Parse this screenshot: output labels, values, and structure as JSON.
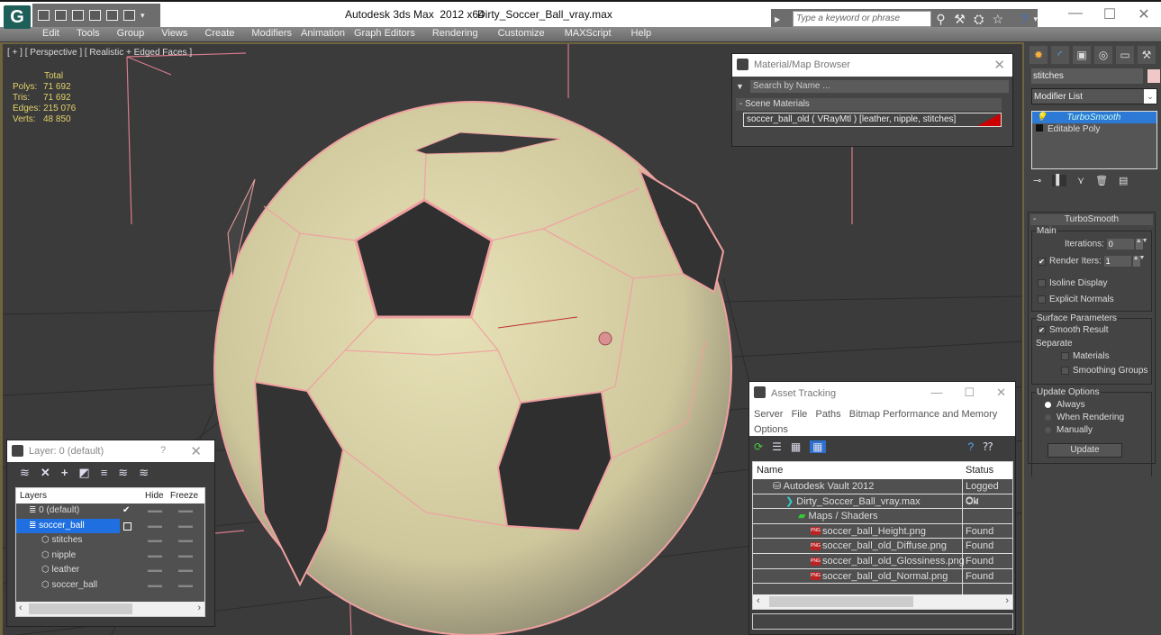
{
  "titlebar": {
    "app_title": "Autodesk 3ds Max  2012 x64",
    "document": "Dirty_Soccer_Ball_vray.max",
    "search_placeholder": "Type a keyword or phrase",
    "help_icon": "?"
  },
  "menu": [
    "Edit",
    "Tools",
    "Group",
    "Views",
    "Create",
    "Modifiers",
    "Animation",
    "Graph Editors",
    "Rendering",
    "Customize",
    "MAXScript",
    "Help"
  ],
  "viewport": {
    "label": "[ + ] [ Perspective ] [ Realistic + Edged Faces ]",
    "stats": {
      "header": "Total",
      "rows": [
        {
          "label": "Polys:",
          "value": "71 692"
        },
        {
          "label": "Tris:",
          "value": "71 692"
        },
        {
          "label": "Edges:",
          "value": "215 076"
        },
        {
          "label": "Verts:",
          "value": "48 850"
        }
      ]
    },
    "wire_color": "#f0a0a0"
  },
  "material_browser": {
    "title": "Material/Map Browser",
    "search_placeholder": "Search by Name ...",
    "group": "- Scene Materials",
    "item": "soccer_ball_old  ( VRayMtl ) [leather, nipple, stitches]"
  },
  "command_panel": {
    "object_name": "stitches",
    "object_color": "#f0c8c8",
    "modifier_list": "Modifier List",
    "stack": [
      {
        "label": "TurboSmooth",
        "selected": true
      },
      {
        "label": "Editable Poly",
        "selected": false
      }
    ],
    "turbosmooth": {
      "title": "TurboSmooth",
      "main_group": "Main",
      "iterations_label": "Iterations:",
      "iterations": "0",
      "render_iters_label": "Render Iters:",
      "render_iters": "1",
      "render_iters_checked": true,
      "isoline_label": "Isoline Display",
      "explicit_normals_label": "Explicit Normals",
      "surface_group": "Surface Parameters",
      "smooth_result_label": "Smooth Result",
      "separate_label": "Separate",
      "materials_label": "Materials",
      "smoothing_groups_label": "Smoothing Groups",
      "update_group": "Update Options",
      "update_options": [
        "Always",
        "When Rendering",
        "Manually"
      ],
      "update_selected": "Always",
      "update_button": "Update"
    }
  },
  "layer_dialog": {
    "title": "Layer: 0 (default)",
    "help": "?",
    "columns": {
      "layers": "Layers",
      "hide": "Hide",
      "freeze": "Freeze"
    },
    "rows": [
      {
        "name": "0 (default)",
        "level": 0,
        "current": true,
        "selected": false
      },
      {
        "name": "soccer_ball",
        "level": 0,
        "current": false,
        "selected": true
      },
      {
        "name": "stitches",
        "level": 1
      },
      {
        "name": "nipple",
        "level": 1
      },
      {
        "name": "leather",
        "level": 1
      },
      {
        "name": "soccer_ball",
        "level": 1
      }
    ]
  },
  "asset_tracking": {
    "title": "Asset Tracking",
    "menu": [
      "Server",
      "File",
      "Paths",
      "Bitmap Performance and Memory",
      "Options"
    ],
    "columns": {
      "name": "Name",
      "status": "Status"
    },
    "rows": [
      {
        "name": "Autodesk Vault 2012",
        "status": "Logged Ou",
        "level": 1
      },
      {
        "name": "Dirty_Soccer_Ball_vray.max",
        "status": "Ok",
        "level": 2
      },
      {
        "name": "Maps / Shaders",
        "status": "",
        "level": 3
      },
      {
        "name": "soccer_ball_Height.png",
        "status": "Found",
        "level": 4
      },
      {
        "name": "soccer_ball_old_Diffuse.png",
        "status": "Found",
        "level": 4
      },
      {
        "name": "soccer_ball_old_Glossiness.png",
        "status": "Found",
        "level": 4
      },
      {
        "name": "soccer_ball_old_Normal.png",
        "status": "Found",
        "level": 4
      }
    ]
  }
}
